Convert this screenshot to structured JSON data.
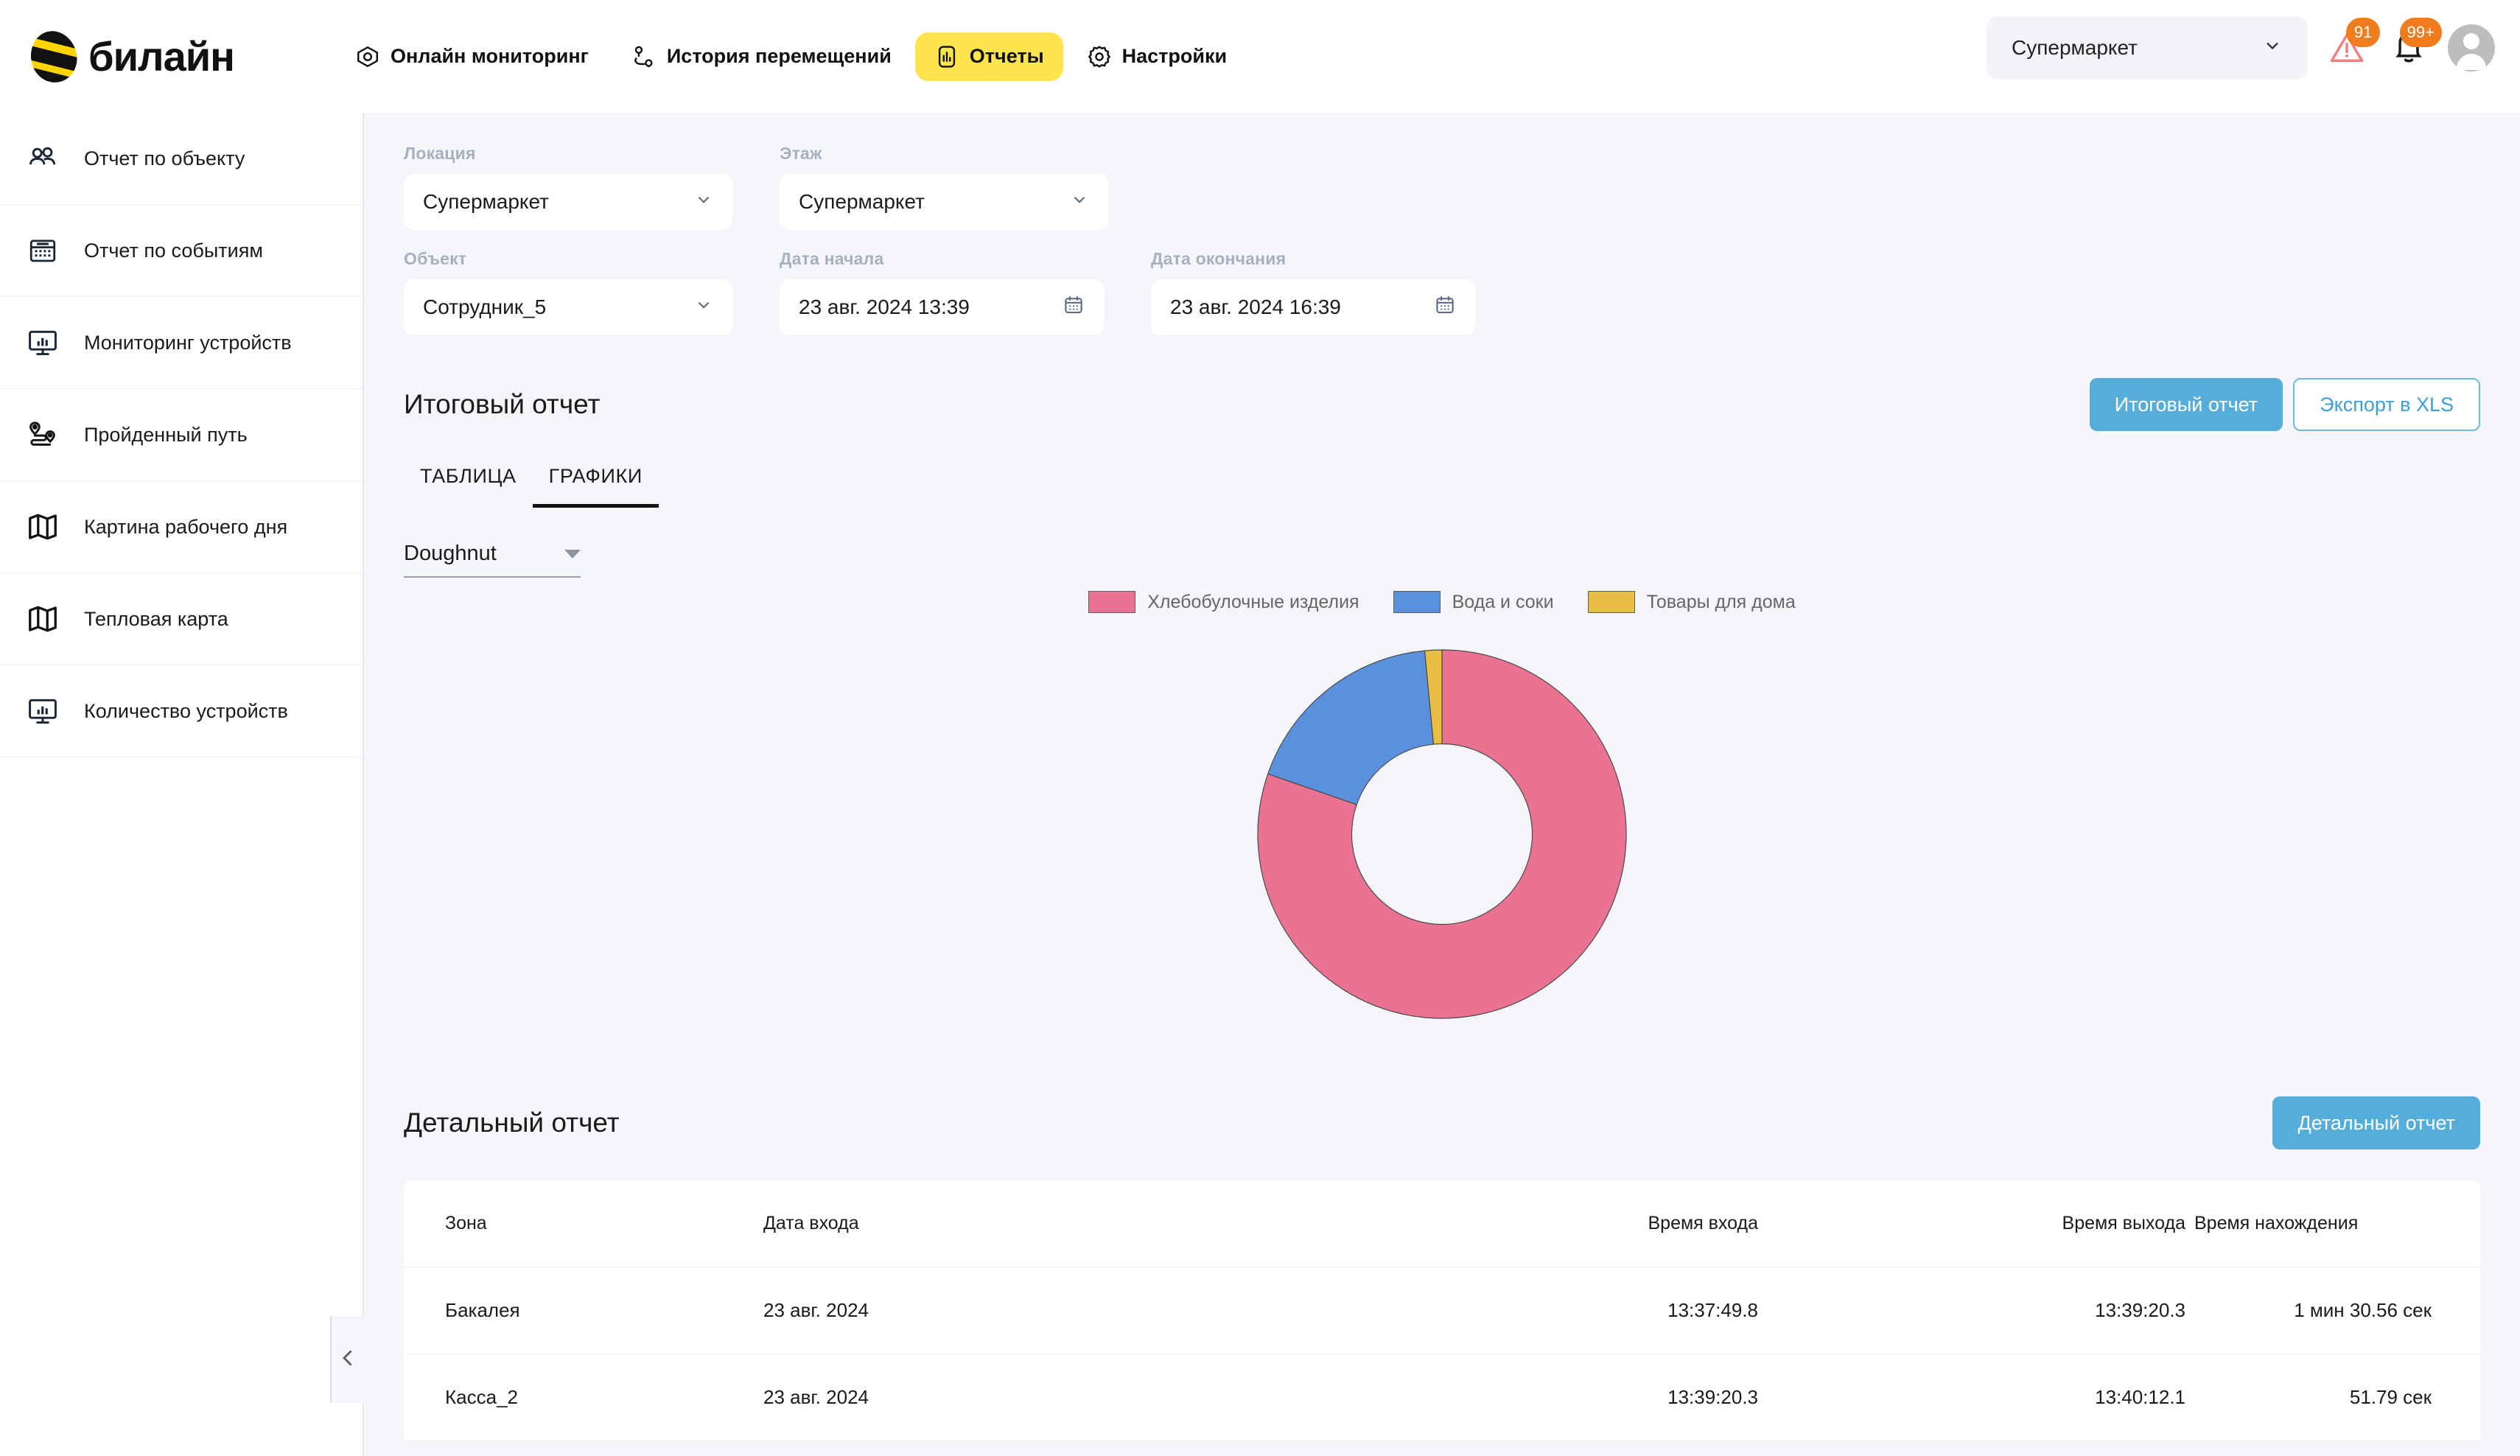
{
  "brand": {
    "name": "билайн",
    "logo_icon": "bee-logo-icon"
  },
  "nav": {
    "items": [
      {
        "label": "Онлайн мониторинг",
        "icon": "eye-icon",
        "active": false
      },
      {
        "label": "История перемещений",
        "icon": "route-icon",
        "active": false
      },
      {
        "label": "Отчеты",
        "icon": "bar-chart-icon",
        "active": true
      },
      {
        "label": "Настройки",
        "icon": "gear-icon",
        "active": false
      }
    ]
  },
  "topright": {
    "location_value": "Супермаркет",
    "alert_badge": "91",
    "bell_badge": "99+"
  },
  "sidebar": {
    "items": [
      {
        "label": "Отчет по объекту",
        "icon": "people-icon"
      },
      {
        "label": "Отчет по событиям",
        "icon": "calendar-icon"
      },
      {
        "label": "Мониторинг устройств",
        "icon": "monitor-chart-icon"
      },
      {
        "label": "Пройденный путь",
        "icon": "route-path-icon"
      },
      {
        "label": "Картина рабочего дня",
        "icon": "map-icon"
      },
      {
        "label": "Тепловая карта",
        "icon": "map-icon"
      },
      {
        "label": "Количество устройств",
        "icon": "monitor-chart-icon"
      }
    ]
  },
  "filters": {
    "location": {
      "label": "Локация",
      "value": "Супермаркет"
    },
    "floor": {
      "label": "Этаж",
      "value": "Супермаркет"
    },
    "object": {
      "label": "Объект",
      "value": "Сотрудник_5"
    },
    "date_start": {
      "label": "Дата начала",
      "value": "23 авг. 2024 13:39"
    },
    "date_end": {
      "label": "Дата окончания",
      "value": "23 авг. 2024 16:39"
    }
  },
  "summary": {
    "title": "Итоговый отчет",
    "primary_button": "Итоговый отчет",
    "export_button": "Экспорт в XLS",
    "tabs": [
      {
        "label": "ТАБЛИЦА",
        "active": false
      },
      {
        "label": "ГРАФИКИ",
        "active": true
      }
    ],
    "chart_type_select": "Doughnut"
  },
  "chart_data": {
    "type": "pie",
    "title": "",
    "variant": "doughnut",
    "legend_position": "top",
    "categories": [
      "Хлебобулочные изделия",
      "Вода и соки",
      "Товары для дома"
    ],
    "values": [
      80.3,
      18.2,
      1.5
    ],
    "unit": "%",
    "colors": [
      "#EA7394",
      "#5B91DC",
      "#E8BE45"
    ],
    "hole_ratio": 0.49
  },
  "detail": {
    "title": "Детальный отчет",
    "button": "Детальный отчет",
    "columns": [
      "Зона",
      "Дата входа",
      "Время входа",
      "Время выхода",
      "Время нахождения"
    ],
    "rows": [
      {
        "zone": "Бакалея",
        "date": "23 авг. 2024",
        "time_in": "13:37:49.8",
        "time_out": "13:39:20.3",
        "duration": "1 мин 30.56 сек"
      },
      {
        "zone": "Касса_2",
        "date": "23 авг. 2024",
        "time_in": "13:39:20.3",
        "time_out": "13:40:12.1",
        "duration": "51.79 сек"
      }
    ]
  },
  "colors": {
    "accent_yellow": "#FFE44D",
    "accent_blue": "#55AEDA",
    "badge_orange": "#F07C1E",
    "page_bg": "#F5F6FA"
  }
}
